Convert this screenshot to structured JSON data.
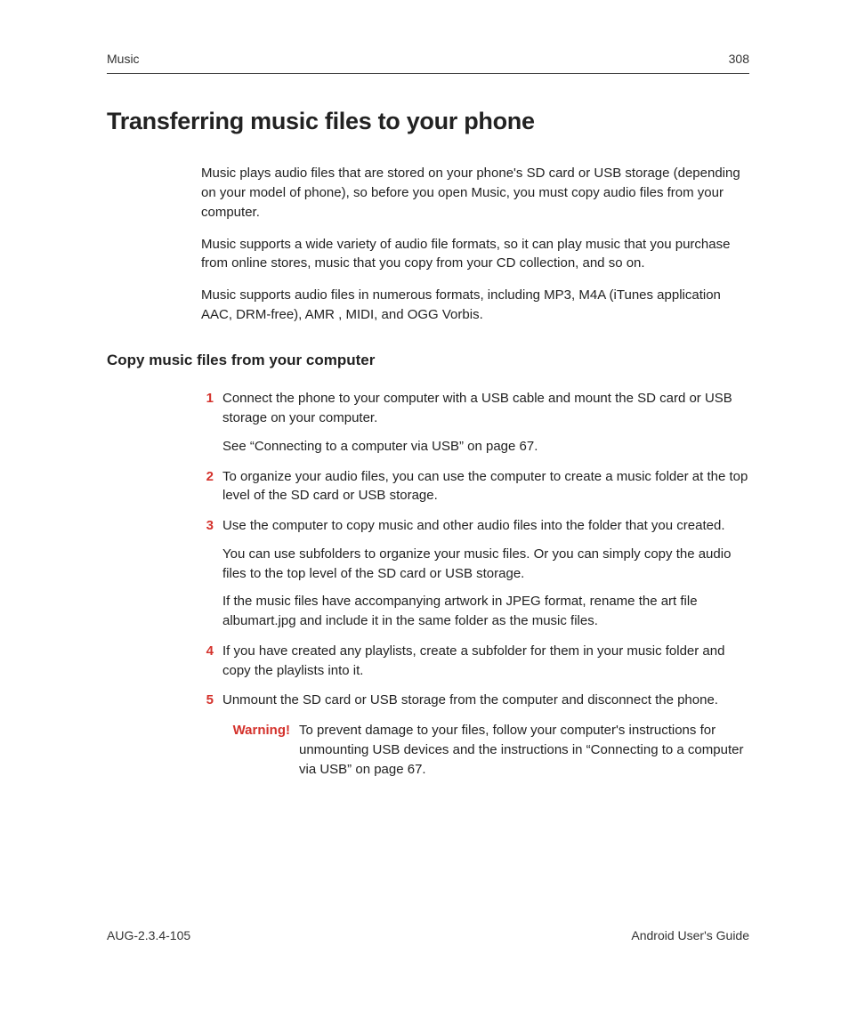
{
  "header": {
    "section": "Music",
    "page_number": "308"
  },
  "title": "Transferring music files to your phone",
  "intro": {
    "p1": "Music plays audio files that are stored on your phone's SD card or USB storage (depending on your model of phone), so before you open Music, you must copy audio files from your computer.",
    "p2": "Music supports a wide variety of audio file formats, so it can play music that you purchase from online stores, music that you copy from your CD collection, and so on.",
    "p3": "Music supports audio files in numerous formats, including MP3, M4A (iTunes application AAC, DRM-free), AMR , MIDI, and OGG Vorbis."
  },
  "subheading": "Copy music files from your computer",
  "steps": [
    {
      "num": "1",
      "paras": [
        "Connect the phone to your computer with a USB cable and mount the SD card or USB storage on your computer.",
        "See “Connecting to a computer via USB” on page 67."
      ]
    },
    {
      "num": "2",
      "paras": [
        "To organize your audio files, you can use the computer to create a music folder at the top level of the SD card or USB storage."
      ]
    },
    {
      "num": "3",
      "paras": [
        "Use the computer to copy music and other audio files into the folder that you created.",
        "You can use subfolders to organize your music files. Or you can simply copy the audio files to the top level of the SD card or USB storage.",
        "If the music files have accompanying artwork in JPEG format, rename the art file albumart.jpg and include it in the same folder as the music files."
      ]
    },
    {
      "num": "4",
      "paras": [
        "If you have created any playlists, create a subfolder for them in your music folder and copy the playlists into it."
      ]
    },
    {
      "num": "5",
      "paras": [
        "Unmount the SD card or USB storage from the computer and disconnect the phone."
      ]
    }
  ],
  "warning": {
    "label": "Warning!",
    "text": "To prevent damage to your files, follow your computer's instructions for unmounting USB devices and the instructions in “Connecting to a computer via USB” on page 67."
  },
  "footer": {
    "left": "AUG-2.3.4-105",
    "right": "Android User's Guide"
  }
}
